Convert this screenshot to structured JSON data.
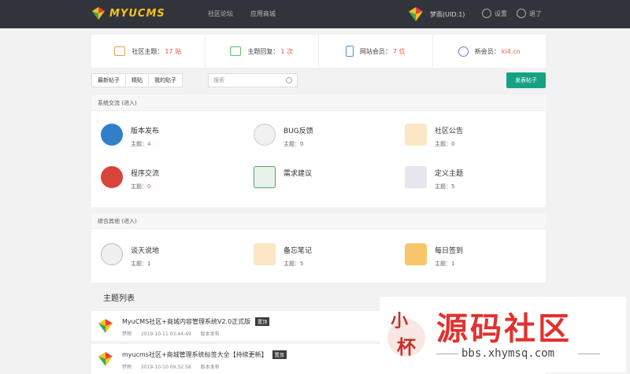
{
  "header": {
    "logo_text": "MYUCMS",
    "nav": [
      "社区论坛",
      "应用商城"
    ],
    "username": "梦雨(UID:1)",
    "settings_label": "设置",
    "logout_label": "退了"
  },
  "stats": [
    {
      "label": "社区主题：",
      "value": "17 贴",
      "color": "#e8a253"
    },
    {
      "label": "主题回复：",
      "value": "1 次",
      "color": "#5fbf65"
    },
    {
      "label": "网站会员：",
      "value": "7 位",
      "color": "#4a8fd9"
    },
    {
      "label": "新会员：",
      "value": "ki4.cn",
      "color": "#8a6bd1"
    }
  ],
  "toolbar": {
    "tabs": [
      "最新帖子",
      "精贴",
      "我的贴子"
    ],
    "search_placeholder": "搜索",
    "post_button": "发表帖子"
  },
  "sections": [
    {
      "title": "系统交流 (进入)",
      "forums": [
        {
          "name": "版本发布",
          "count_label": "主题：",
          "count": "4",
          "color": "#2f7fc9"
        },
        {
          "name": "BUG反馈",
          "count_label": "主题：",
          "count": "0",
          "color": "#3a3a3a"
        },
        {
          "name": "社区公告",
          "count_label": "主题：",
          "count": "0",
          "color": "#e8a253"
        },
        {
          "name": "程序交流",
          "count_label": "主题：",
          "count": "0",
          "color": "#d9443a"
        },
        {
          "name": "需求建议",
          "count_label": "主题：",
          "count": "",
          "color": "#4aa56a"
        },
        {
          "name": "定义主题",
          "count_label": "主题：",
          "count": "5",
          "color": "#6a6a8a"
        }
      ]
    },
    {
      "title": "综合其他 (进入)",
      "forums": [
        {
          "name": "谈天说地",
          "count_label": "主题：",
          "count": "1",
          "color": "#888888"
        },
        {
          "name": "备忘笔记",
          "count_label": "主题：",
          "count": "5",
          "color": "#e8a253"
        },
        {
          "name": "每日签到",
          "count_label": "主题：",
          "count": "1",
          "color": "#ef6a8a"
        }
      ]
    }
  ],
  "thread_list": {
    "title": "主题列表",
    "threads": [
      {
        "title": "MyuCMS社区+商城内容管理系统V2.0正式版",
        "badge": "置顶",
        "date": "2019-10-11 03:44:49",
        "author": "梦雨",
        "forum": "版本发布"
      },
      {
        "title": "myucms社区+商城管理系统标签大全【持续更新】",
        "badge": "置顶",
        "date": "2019-10-10 09:32:58",
        "author": "梦雨",
        "forum": "版本发布"
      }
    ]
  },
  "watermark": {
    "seal_text": "小 杯",
    "big_text": "源码社区",
    "url": "bbs.xhymsq.com"
  }
}
